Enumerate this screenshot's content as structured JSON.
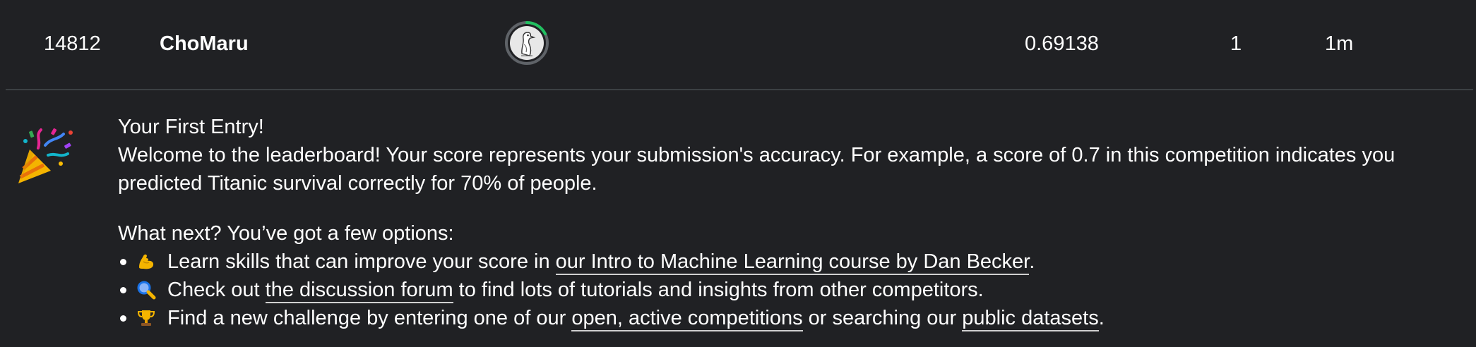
{
  "leaderboard_row": {
    "rank": "14812",
    "team_name": "ChoMaru",
    "score": "0.69138",
    "entries": "1",
    "last_submission": "1m",
    "avatar_icon": "goose-avatar-icon",
    "avatar_ring_color": "#20c060"
  },
  "notice": {
    "icon": "party-popper-icon",
    "title": "Your First Entry!",
    "welcome_text": "Welcome to the leaderboard! Your score represents your submission's accuracy. For example, a score of 0.7 in this competition indicates you predicted Titanic survival correctly for 70% of people.",
    "next_heading": "What next? You’ve got a few options:",
    "options": [
      {
        "icon": "flexed-biceps-icon",
        "text_before": "Learn skills that can improve your score in ",
        "link": "our Intro to Machine Learning course by Dan Becker",
        "text_after": "."
      },
      {
        "icon": "magnifying-glass-icon",
        "text_before": "Check out ",
        "link": "the discussion forum",
        "text_after": " to find lots of tutorials and insights from other competitors."
      },
      {
        "icon": "trophy-icon",
        "text_before": "Find a new challenge by entering one of our ",
        "link": "open, active competitions",
        "text_middle": " or searching our ",
        "link2": "public datasets",
        "text_after": "."
      }
    ]
  }
}
